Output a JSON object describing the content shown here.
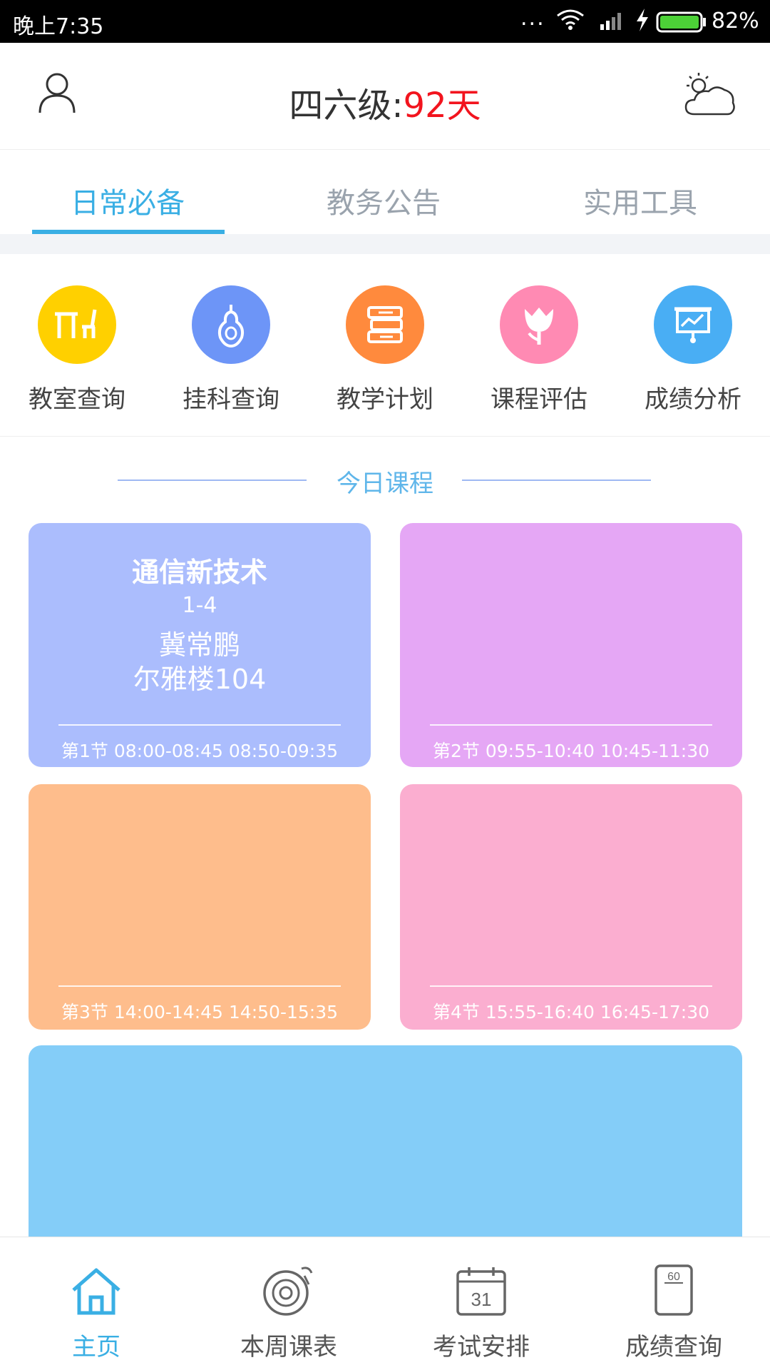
{
  "status_bar": {
    "time": "晚上7:35",
    "dots": "...",
    "battery_percent": "82%",
    "icons": [
      "wifi-icon",
      "signal-icon",
      "charging-icon",
      "battery-icon"
    ]
  },
  "header": {
    "exam_label": "四六级:",
    "exam_days": "92天",
    "days_color": "#f2141e",
    "icons": [
      "user-icon",
      "weather-icon"
    ]
  },
  "tabs": [
    {
      "label": "日常必备",
      "active": true
    },
    {
      "label": "教务公告",
      "active": false
    },
    {
      "label": "实用工具",
      "active": false
    }
  ],
  "accent_color": "#3aafe4",
  "quick_links": [
    {
      "label": "教室查询",
      "icon": "desk-chair-icon",
      "color": "#ffd000"
    },
    {
      "label": "挂科查询",
      "icon": "pear-icon",
      "color": "#6d95f7"
    },
    {
      "label": "教学计划",
      "icon": "books-icon",
      "color": "#ff8a3d"
    },
    {
      "label": "课程评估",
      "icon": "tulip-icon",
      "color": "#ff8ab3"
    },
    {
      "label": "成绩分析",
      "icon": "presentation-icon",
      "color": "#49aef4"
    }
  ],
  "today": {
    "title": "今日课程",
    "cards": [
      {
        "name": "通信新技术",
        "weeks": "1-4",
        "teacher": "冀常鹏",
        "room": "尔雅楼104",
        "period": "第1节 08:00-08:45 08:50-09:35",
        "color": "#abbdfd"
      },
      {
        "name": "",
        "weeks": "",
        "teacher": "",
        "room": "",
        "period": "第2节 09:55-10:40 10:45-11:30",
        "color": "#e5a7f5"
      },
      {
        "name": "",
        "weeks": "",
        "teacher": "",
        "room": "",
        "period": "第3节 14:00-14:45 14:50-15:35",
        "color": "#febd8c"
      },
      {
        "name": "",
        "weeks": "",
        "teacher": "",
        "room": "",
        "period": "第4节 15:55-16:40 16:45-17:30",
        "color": "#fbaed0"
      },
      {
        "color": "#84cdf8"
      }
    ]
  },
  "bottom_nav": [
    {
      "label": "主页",
      "icon": "home-icon",
      "active": true
    },
    {
      "label": "本周课表",
      "icon": "record-player-icon",
      "active": false
    },
    {
      "label": "考试安排",
      "icon": "calendar-icon",
      "active": false,
      "calendar_number": "31"
    },
    {
      "label": "成绩查询",
      "icon": "score-paper-icon",
      "active": false,
      "paper_number": "60"
    }
  ]
}
